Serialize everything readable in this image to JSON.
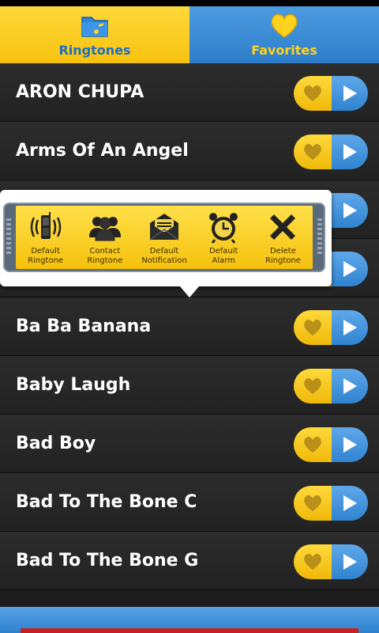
{
  "tabs": [
    {
      "label": "Ringtones",
      "active": true,
      "icon": "folder-music-icon"
    },
    {
      "label": "Favorites",
      "active": false,
      "icon": "heart-icon"
    }
  ],
  "songs": [
    {
      "title": "ARON CHUPA"
    },
    {
      "title": "Arms Of An Angel"
    },
    {
      "title": ""
    },
    {
      "title": ""
    },
    {
      "title": "Ba Ba Banana"
    },
    {
      "title": "Baby Laugh"
    },
    {
      "title": "Bad Boy"
    },
    {
      "title": "Bad To The Bone C"
    },
    {
      "title": "Bad To The Bone G"
    }
  ],
  "popup": {
    "actions": [
      {
        "label": "Default\nRingtone",
        "icon": "ringing-phone-icon"
      },
      {
        "label": "Contact\nRingtone",
        "icon": "contacts-group-icon"
      },
      {
        "label": "Default\nNotification",
        "icon": "envelope-icon"
      },
      {
        "label": "Default\nAlarm",
        "icon": "alarm-clock-icon"
      },
      {
        "label": "Delete\nRingtone",
        "icon": "delete-x-icon"
      }
    ]
  },
  "colors": {
    "yellow": "#f7c20e",
    "blue": "#2c7dcb",
    "heart": "#b8901a",
    "row_bg": "#262626"
  }
}
